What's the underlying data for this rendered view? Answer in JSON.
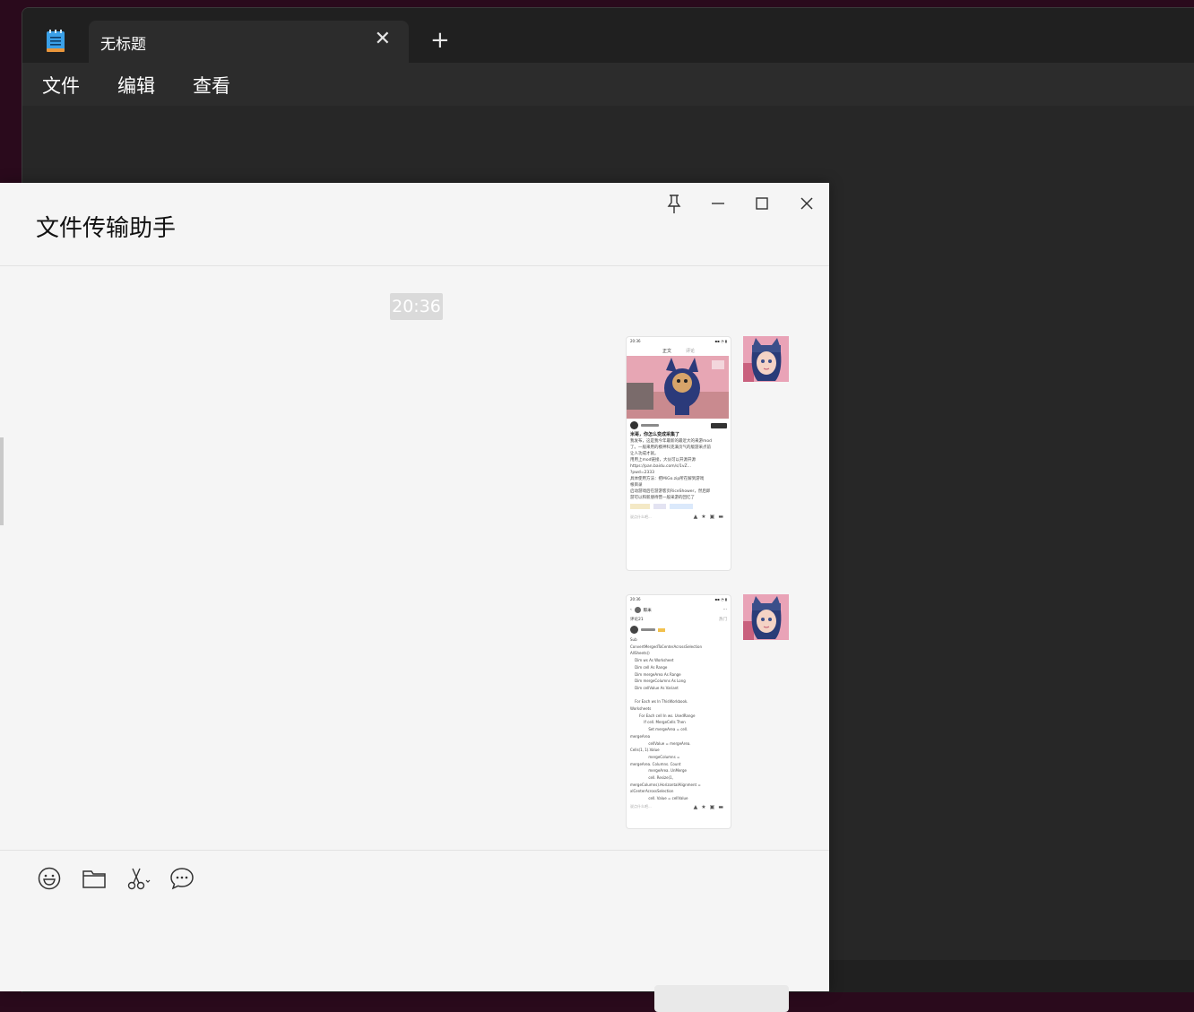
{
  "notepad": {
    "tab_title": "无标题",
    "close_glyph": "✕",
    "new_tab_glyph": "+",
    "menu": [
      "文件",
      "编辑",
      "查看"
    ]
  },
  "chat": {
    "title": "文件传输助手",
    "timestamp": "20:36",
    "messages": [
      {
        "type": "image",
        "thumb_status": "20:36",
        "thumb_tabs": [
          "正文",
          "评论"
        ],
        "thumb_title": "米哥，你怎么变成采集了",
        "thumb_text": "我发布，这是我今年最新的最近大的来游mod\n了。一般来用的模神科克满页气的版游采点前\n让人功成才就。\n用用上mod链接，大伙可以开源开源\nhttps://pan.baidu.com/s/1vZ...\n?pwd=2333\n具体使用方法：把MiGo.zip所在解到游戏\n根目录\n启动游戏后在游游客页RiceShower，然后即\n游可以和新朋待营一般采游的回忆了",
        "thumb_input": "说点什么吧..."
      },
      {
        "type": "image",
        "thumb_status": "20:36",
        "thumb_author": "粽米",
        "thumb_count": "评论21",
        "thumb_sort": "热门",
        "thumb_code": "Sub\nConvertMergedToCenterAcrossSelection\nAllSheets()\n    Dim ws As Worksheet\n    Dim cell As Range\n    Dim mergeArea As Range\n    Dim mergeColumns As Long\n    Dim cellValue As Variant\n\n    For Each ws In ThisWorkbook.\nWorksheets\n        For Each cell In ws. UsedRange\n            If cell. MergeCells Then\n                Set mergeArea = cell.\nmergeArea\n                cellValue = mergeArea.\nCells(1, 1).Value\n                mergeColumns =\nmergeArea. Columns. Count\n                mergeArea. UnMerge\n                cell. Resize(1,\nmergeColumns).HorizontalAlignment =\nxlCenterAcrossSelection\n                cell. Value = cellValue",
        "thumb_input": "说点什么吧..."
      }
    ]
  },
  "icons": {
    "notepad_app": "notepad-icon",
    "pin": "pin-icon",
    "minimize": "minimize-icon",
    "maximize": "maximize-icon",
    "close": "close-icon",
    "emoji": "emoji-icon",
    "folder": "folder-icon",
    "screenshot": "scissors-icon",
    "chat_history": "chat-bubble-icon"
  },
  "colors": {
    "notepad_bg": "#202020",
    "notepad_tab": "#2c2c2c",
    "chat_bg": "#f5f5f5",
    "timestamp_bg": "#dadada"
  }
}
